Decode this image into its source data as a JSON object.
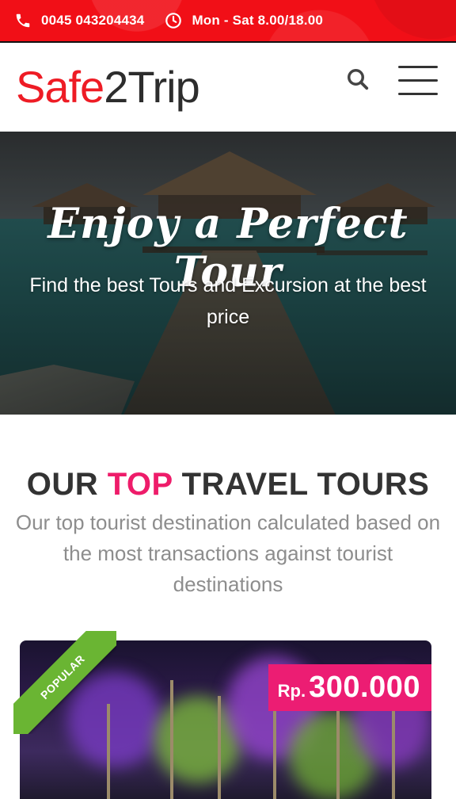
{
  "topbar": {
    "phone": "0045 043204434",
    "hours": "Mon - Sat 8.00/18.00",
    "phone_icon": "phone-icon",
    "clock_icon": "clock-icon",
    "color": "#f10f17"
  },
  "header": {
    "logo_part1": "Safe",
    "logo_part2": "2Trip",
    "search_icon": "search-icon",
    "menu_icon": "hamburger-menu-icon"
  },
  "hero": {
    "title": "Enjoy a Perfect Tour",
    "subtitle": "Find the best Tours and Excursion at the best price"
  },
  "section": {
    "title_part1": "OUR ",
    "title_accent": "TOP",
    "title_part2": " TRAVEL TOURS",
    "description": "Our top tourist destination calculated based on the most transactions against tourist destinations"
  },
  "card": {
    "badge": "POPULAR",
    "currency": "Rp.",
    "price": "300.000",
    "badge_color": "#6ab533",
    "price_color": "#ec1d73"
  }
}
